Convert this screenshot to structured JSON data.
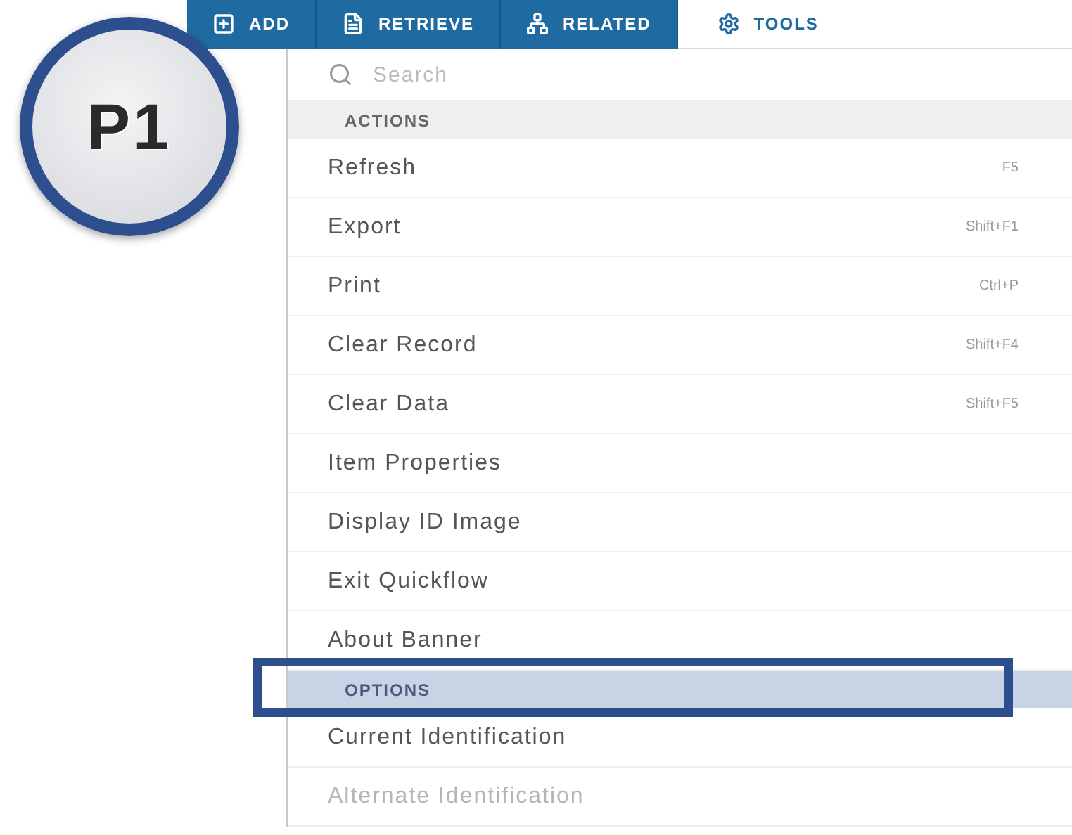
{
  "callout": {
    "label": "P1"
  },
  "tabs": [
    {
      "label": "ADD",
      "selected": false
    },
    {
      "label": "RETRIEVE",
      "selected": false
    },
    {
      "label": "RELATED",
      "selected": false
    },
    {
      "label": "TOOLS",
      "selected": true
    }
  ],
  "search": {
    "placeholder": "Search"
  },
  "sections": [
    {
      "title": "ACTIONS",
      "highlighted": false,
      "items": [
        {
          "label": "Refresh",
          "shortcut": "F5",
          "disabled": false
        },
        {
          "label": "Export",
          "shortcut": "Shift+F1",
          "disabled": false
        },
        {
          "label": "Print",
          "shortcut": "Ctrl+P",
          "disabled": false
        },
        {
          "label": "Clear Record",
          "shortcut": "Shift+F4",
          "disabled": false
        },
        {
          "label": "Clear Data",
          "shortcut": "Shift+F5",
          "disabled": false
        },
        {
          "label": "Item Properties",
          "disabled": false
        },
        {
          "label": "Display ID Image",
          "disabled": false
        },
        {
          "label": "Exit Quickflow",
          "disabled": false
        },
        {
          "label": "About Banner",
          "disabled": false
        }
      ]
    },
    {
      "title": "OPTIONS",
      "highlighted": true,
      "items": [
        {
          "label": "Current Identification",
          "disabled": false
        },
        {
          "label": "Alternate Identification",
          "disabled": true
        }
      ]
    }
  ]
}
